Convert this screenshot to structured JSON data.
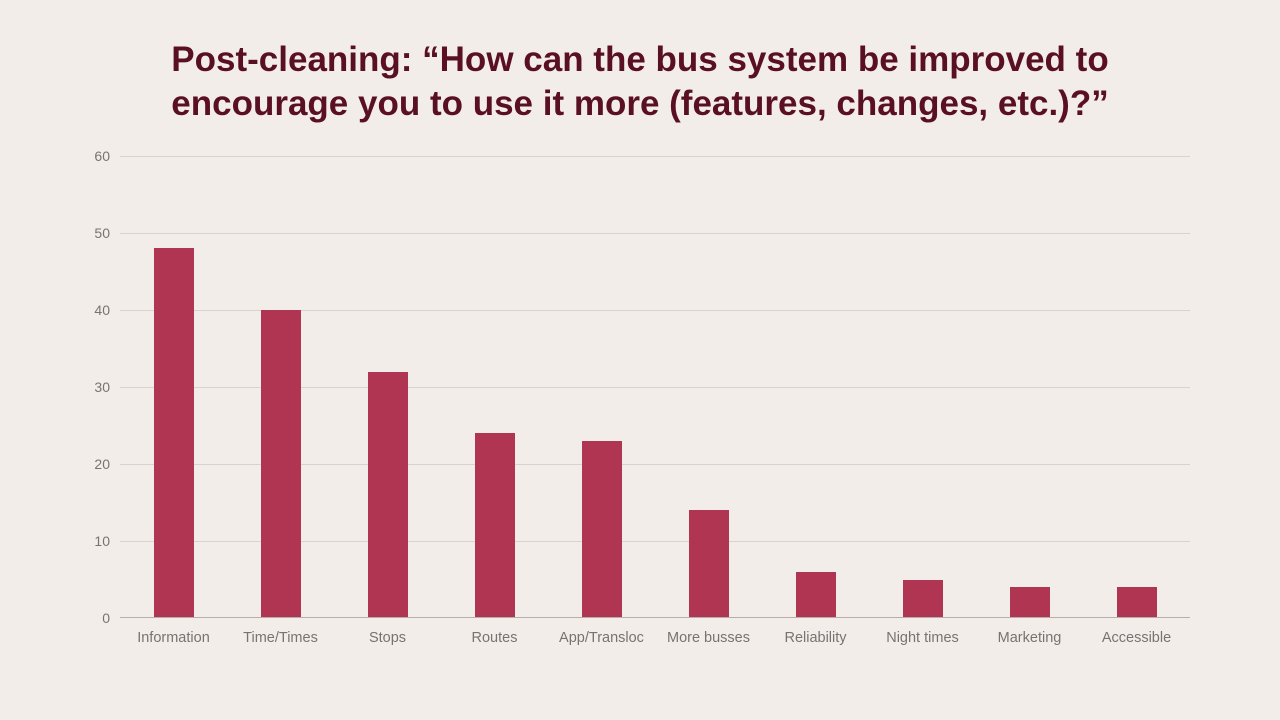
{
  "title": "Post-cleaning: “How can the bus system be improved to encourage you to use it more (features, changes, etc.)?”",
  "chart_data": {
    "type": "bar",
    "title": "Post-cleaning: “How can the bus system be improved to encourage you to use it more (features, changes, etc.)?”",
    "categories": [
      "Information",
      "Time/Times",
      "Stops",
      "Routes",
      "App/Transloc",
      "More busses",
      "Reliability",
      "Night times",
      "Marketing",
      "Accessible"
    ],
    "values": [
      48,
      40,
      32,
      24,
      23,
      14,
      6,
      5,
      4,
      4
    ],
    "xlabel": "",
    "ylabel": "",
    "ylim": [
      0,
      60
    ],
    "y_ticks": [
      0,
      10,
      20,
      30,
      40,
      50,
      60
    ],
    "bar_color": "#af3552",
    "grid": true
  }
}
